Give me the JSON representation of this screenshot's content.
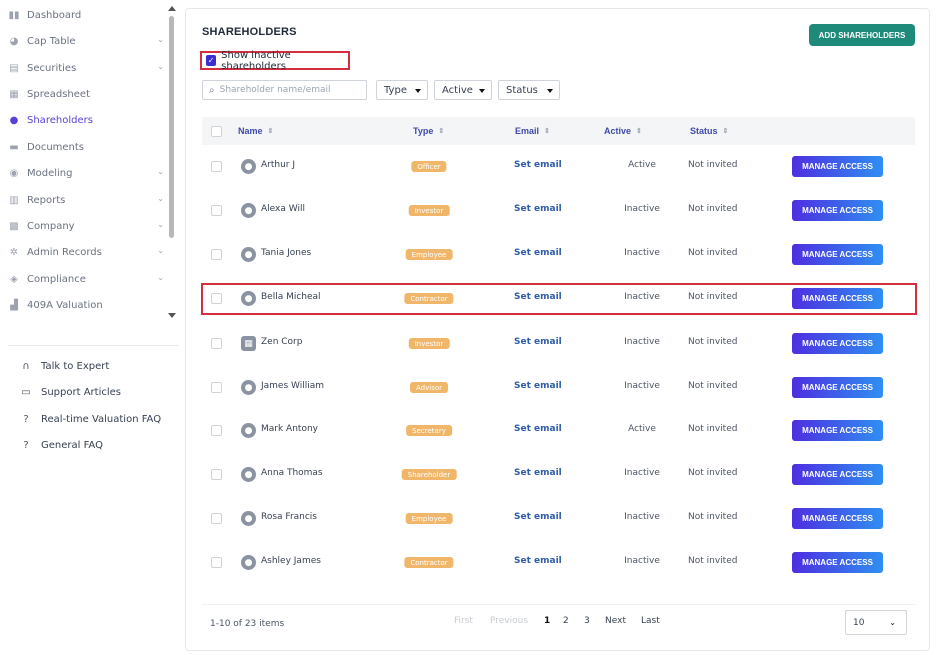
{
  "sidebar": {
    "items": [
      {
        "label": "Dashboard",
        "icon": "dashboard-icon",
        "glyph": "▮▮",
        "chevron": false,
        "active": false
      },
      {
        "label": "Cap Table",
        "icon": "pie-chart-icon",
        "glyph": "◕",
        "chevron": true,
        "active": false
      },
      {
        "label": "Securities",
        "icon": "clipboard-icon",
        "glyph": "▤",
        "chevron": true,
        "active": false
      },
      {
        "label": "Spreadsheet",
        "icon": "spreadsheet-icon",
        "glyph": "▦",
        "chevron": false,
        "active": false
      },
      {
        "label": "Shareholders",
        "icon": "user-icon",
        "glyph": "●",
        "chevron": false,
        "active": true
      },
      {
        "label": "Documents",
        "icon": "folder-icon",
        "glyph": "▬",
        "chevron": false,
        "active": false
      },
      {
        "label": "Modeling",
        "icon": "lightbulb-icon",
        "glyph": "◉",
        "chevron": true,
        "active": false
      },
      {
        "label": "Reports",
        "icon": "report-icon",
        "glyph": "▥",
        "chevron": true,
        "active": false
      },
      {
        "label": "Company",
        "icon": "building-icon",
        "glyph": "▩",
        "chevron": true,
        "active": false
      },
      {
        "label": "Admin Records",
        "icon": "gear-icon",
        "glyph": "✲",
        "chevron": true,
        "active": false
      },
      {
        "label": "Compliance",
        "icon": "shield-check-icon",
        "glyph": "◈",
        "chevron": true,
        "active": false
      },
      {
        "label": "409A Valuation",
        "icon": "bar-chart-icon",
        "glyph": "▟",
        "chevron": false,
        "active": false
      }
    ],
    "help": [
      {
        "label": "Talk to Expert",
        "icon": "headset-icon",
        "glyph": "∩"
      },
      {
        "label": "Support Articles",
        "icon": "book-icon",
        "glyph": "▭"
      },
      {
        "label": "Real-time Valuation FAQ",
        "icon": "question-circle-icon",
        "glyph": "?"
      },
      {
        "label": "General FAQ",
        "icon": "question-circle-icon",
        "glyph": "?"
      }
    ]
  },
  "main": {
    "title": "SHAREHOLDERS",
    "add_button": "ADD SHAREHOLDERS",
    "show_inactive_label": "Show inactive shareholders",
    "show_inactive_checked": true,
    "search_placeholder": "Shareholder name/email",
    "filters": [
      "Type",
      "Active",
      "Status"
    ],
    "columns": [
      "Name",
      "Type",
      "Email",
      "Active",
      "Status"
    ],
    "manage_label": "MANAGE ACCESS",
    "rows": [
      {
        "name": "Arthur J",
        "type": "Officer",
        "email": "Set email",
        "active": "Active",
        "status": "Not invited",
        "corp": false
      },
      {
        "name": "Alexa Will",
        "type": "Investor",
        "email": "Set email",
        "active": "Inactive",
        "status": "Not invited",
        "corp": false
      },
      {
        "name": "Tania Jones",
        "type": "Employee",
        "email": "Set email",
        "active": "Inactive",
        "status": "Not invited",
        "corp": false
      },
      {
        "name": "Bella Micheal",
        "type": "Contractor",
        "email": "Set email",
        "active": "Inactive",
        "status": "Not invited",
        "corp": false,
        "highlighted": true
      },
      {
        "name": "Zen Corp",
        "type": "Investor",
        "email": "Set email",
        "active": "Inactive",
        "status": "Not invited",
        "corp": true
      },
      {
        "name": "James William",
        "type": "Advisor",
        "email": "Set email",
        "active": "Inactive",
        "status": "Not invited",
        "corp": false
      },
      {
        "name": "Mark Antony",
        "type": "Secretary",
        "email": "Set email",
        "active": "Active",
        "status": "Not invited",
        "corp": false
      },
      {
        "name": "Anna Thomas",
        "type": "Shareholder",
        "email": "Set email",
        "active": "Inactive",
        "status": "Not invited",
        "corp": false
      },
      {
        "name": "Rosa Francis",
        "type": "Employee",
        "email": "Set email",
        "active": "Inactive",
        "status": "Not invited",
        "corp": false
      },
      {
        "name": "Ashley James",
        "type": "Contractor",
        "email": "Set email",
        "active": "Inactive",
        "status": "Not invited",
        "corp": false
      }
    ],
    "footer": {
      "range": "1-10 of 23 items",
      "first": "First",
      "previous": "Previous",
      "pages": [
        "1",
        "2",
        "3"
      ],
      "current_page": "1",
      "next": "Next",
      "last": "Last",
      "per_page": "10"
    }
  },
  "colors": {
    "accent": "#5b3fd6",
    "add_button": "#1f8a7a",
    "badge": "#f0b76a",
    "highlight": "#d32f3f"
  }
}
